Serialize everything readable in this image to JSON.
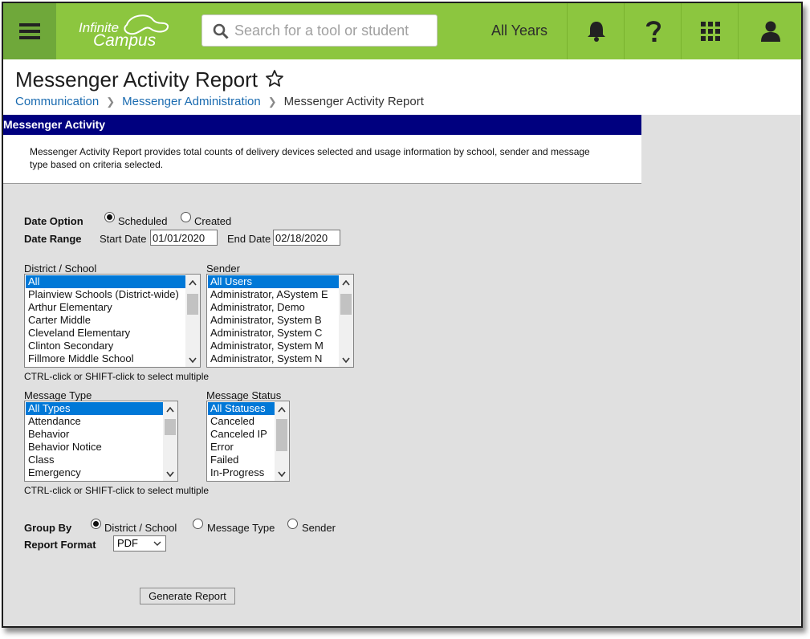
{
  "header": {
    "logo_text_1": "Infinite",
    "logo_text_2": "Campus",
    "search_placeholder": "Search for a tool or student",
    "year_label": "All Years",
    "icons": [
      "menu-icon",
      "bell-icon",
      "help-icon",
      "apps-grid-icon",
      "user-icon"
    ],
    "colors": {
      "bar": "#8cc63f",
      "menu_bg": "#6fa83a"
    }
  },
  "page": {
    "title": "Messenger Activity Report",
    "breadcrumb": [
      "Communication",
      "Messenger Administration",
      "Messenger Activity Report"
    ]
  },
  "panel": {
    "heading": "Messenger Activity",
    "description": "Messenger Activity Report provides total counts of delivery devices selected and usage information by school, sender and message type based on criteria selected.",
    "heading_color": "#00007f"
  },
  "form": {
    "date_option": {
      "label": "Date Option",
      "options": [
        "Scheduled",
        "Created"
      ],
      "selected": "Scheduled"
    },
    "date_range": {
      "label": "Date Range",
      "start_label": "Start Date",
      "start_value": "01/01/2020",
      "end_label": "End Date",
      "end_value": "02/18/2020"
    },
    "district_school": {
      "label": "District / School",
      "items": [
        "All",
        "Plainview Schools (District-wide)",
        "Arthur Elementary",
        "Carter Middle",
        "Cleveland Elementary",
        "Clinton Secondary",
        "Fillmore Middle School"
      ],
      "selected": "All"
    },
    "sender": {
      "label": "Sender",
      "items": [
        "All Users",
        "Administrator, ASystem E",
        "Administrator, Demo",
        "Administrator, System B",
        "Administrator, System C",
        "Administrator, System M",
        "Administrator, System N"
      ],
      "selected": "All Users"
    },
    "hint": "CTRL-click or SHIFT-click to select multiple",
    "message_type": {
      "label": "Message Type",
      "items": [
        "All Types",
        "Attendance",
        "Behavior",
        "Behavior Notice",
        "Class",
        "Emergency"
      ],
      "selected": "All Types"
    },
    "message_status": {
      "label": "Message Status",
      "items": [
        "All Statuses",
        "Canceled",
        "Canceled IP",
        "Error",
        "Failed",
        "In-Progress"
      ],
      "selected": "All Statuses"
    },
    "group_by": {
      "label": "Group By",
      "options": [
        "District / School",
        "Message Type",
        "Sender"
      ],
      "selected": "District / School"
    },
    "report_format": {
      "label": "Report Format",
      "value": "PDF"
    },
    "generate_label": "Generate Report"
  }
}
